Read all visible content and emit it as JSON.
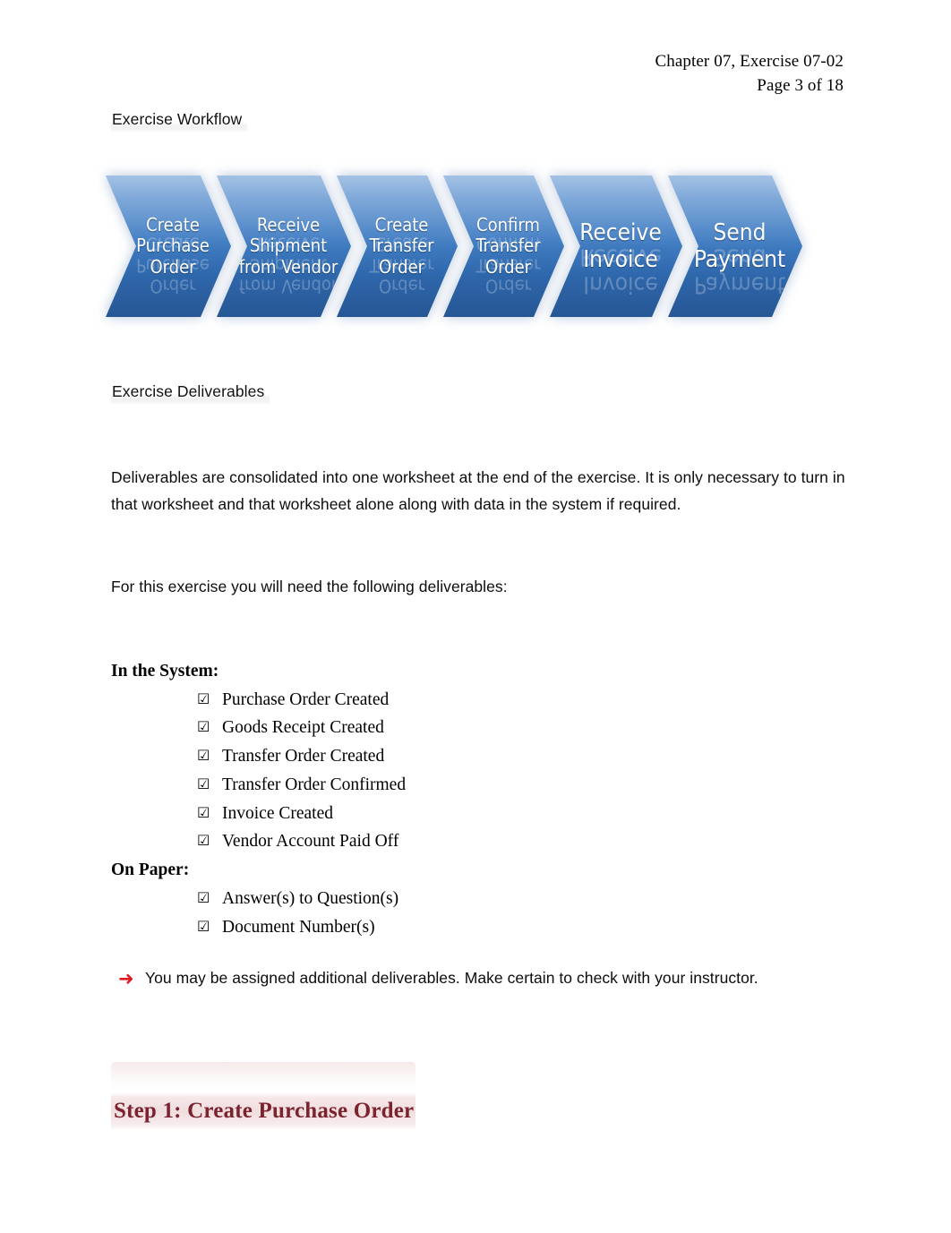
{
  "header": {
    "line1": "Chapter 07, Exercise 07-02",
    "line2": "Page 3 of 18"
  },
  "sections": {
    "workflow_heading": "Exercise Workflow",
    "deliverables_heading": "Exercise Deliverables"
  },
  "workflow": {
    "steps": [
      {
        "lines": [
          "Create",
          "Purchase",
          "Order"
        ],
        "size": "sm"
      },
      {
        "lines": [
          "Receive",
          "Shipment",
          "from Vendor"
        ],
        "size": "sm"
      },
      {
        "lines": [
          "Create",
          "Transfer",
          "Order"
        ],
        "size": "sm"
      },
      {
        "lines": [
          "Confirm",
          "Transfer",
          "Order"
        ],
        "size": "sm"
      },
      {
        "lines": [
          "Receive",
          "Invoice"
        ],
        "size": "lg"
      },
      {
        "lines": [
          "Send",
          "Payment"
        ],
        "size": "lg"
      }
    ],
    "colors": {
      "gradient_top": "#7ba7d9",
      "gradient_bottom": "#285b9c",
      "label": "#ffffff"
    }
  },
  "paragraphs": {
    "deliverables_intro": "Deliverables are consolidated into one worksheet at the end of the exercise. It is only necessary to turn in that worksheet and that worksheet alone along with data in the system if required.",
    "for_this_exercise": "For this exercise you will need the following deliverables:"
  },
  "deliverables": {
    "checkbox_glyph": "☑",
    "groups": [
      {
        "title": "In the System:",
        "items": [
          "Purchase Order Created",
          "Goods Receipt Created",
          "Transfer Order Created",
          "Transfer Order Confirmed",
          "Invoice Created",
          "Vendor Account Paid Off"
        ]
      },
      {
        "title": "On Paper:",
        "items": [
          "Answer(s) to Question(s)",
          "Document Number(s)"
        ]
      }
    ]
  },
  "note": {
    "arrow_glyph": "➜",
    "arrow_color": "#e01b24",
    "text": "You may be assigned additional deliverables. Make certain to check with your instructor."
  },
  "step": {
    "title": "Step 1: Create Purchase Order",
    "title_color": "#7b2430",
    "band_color": "#eed8d9"
  }
}
